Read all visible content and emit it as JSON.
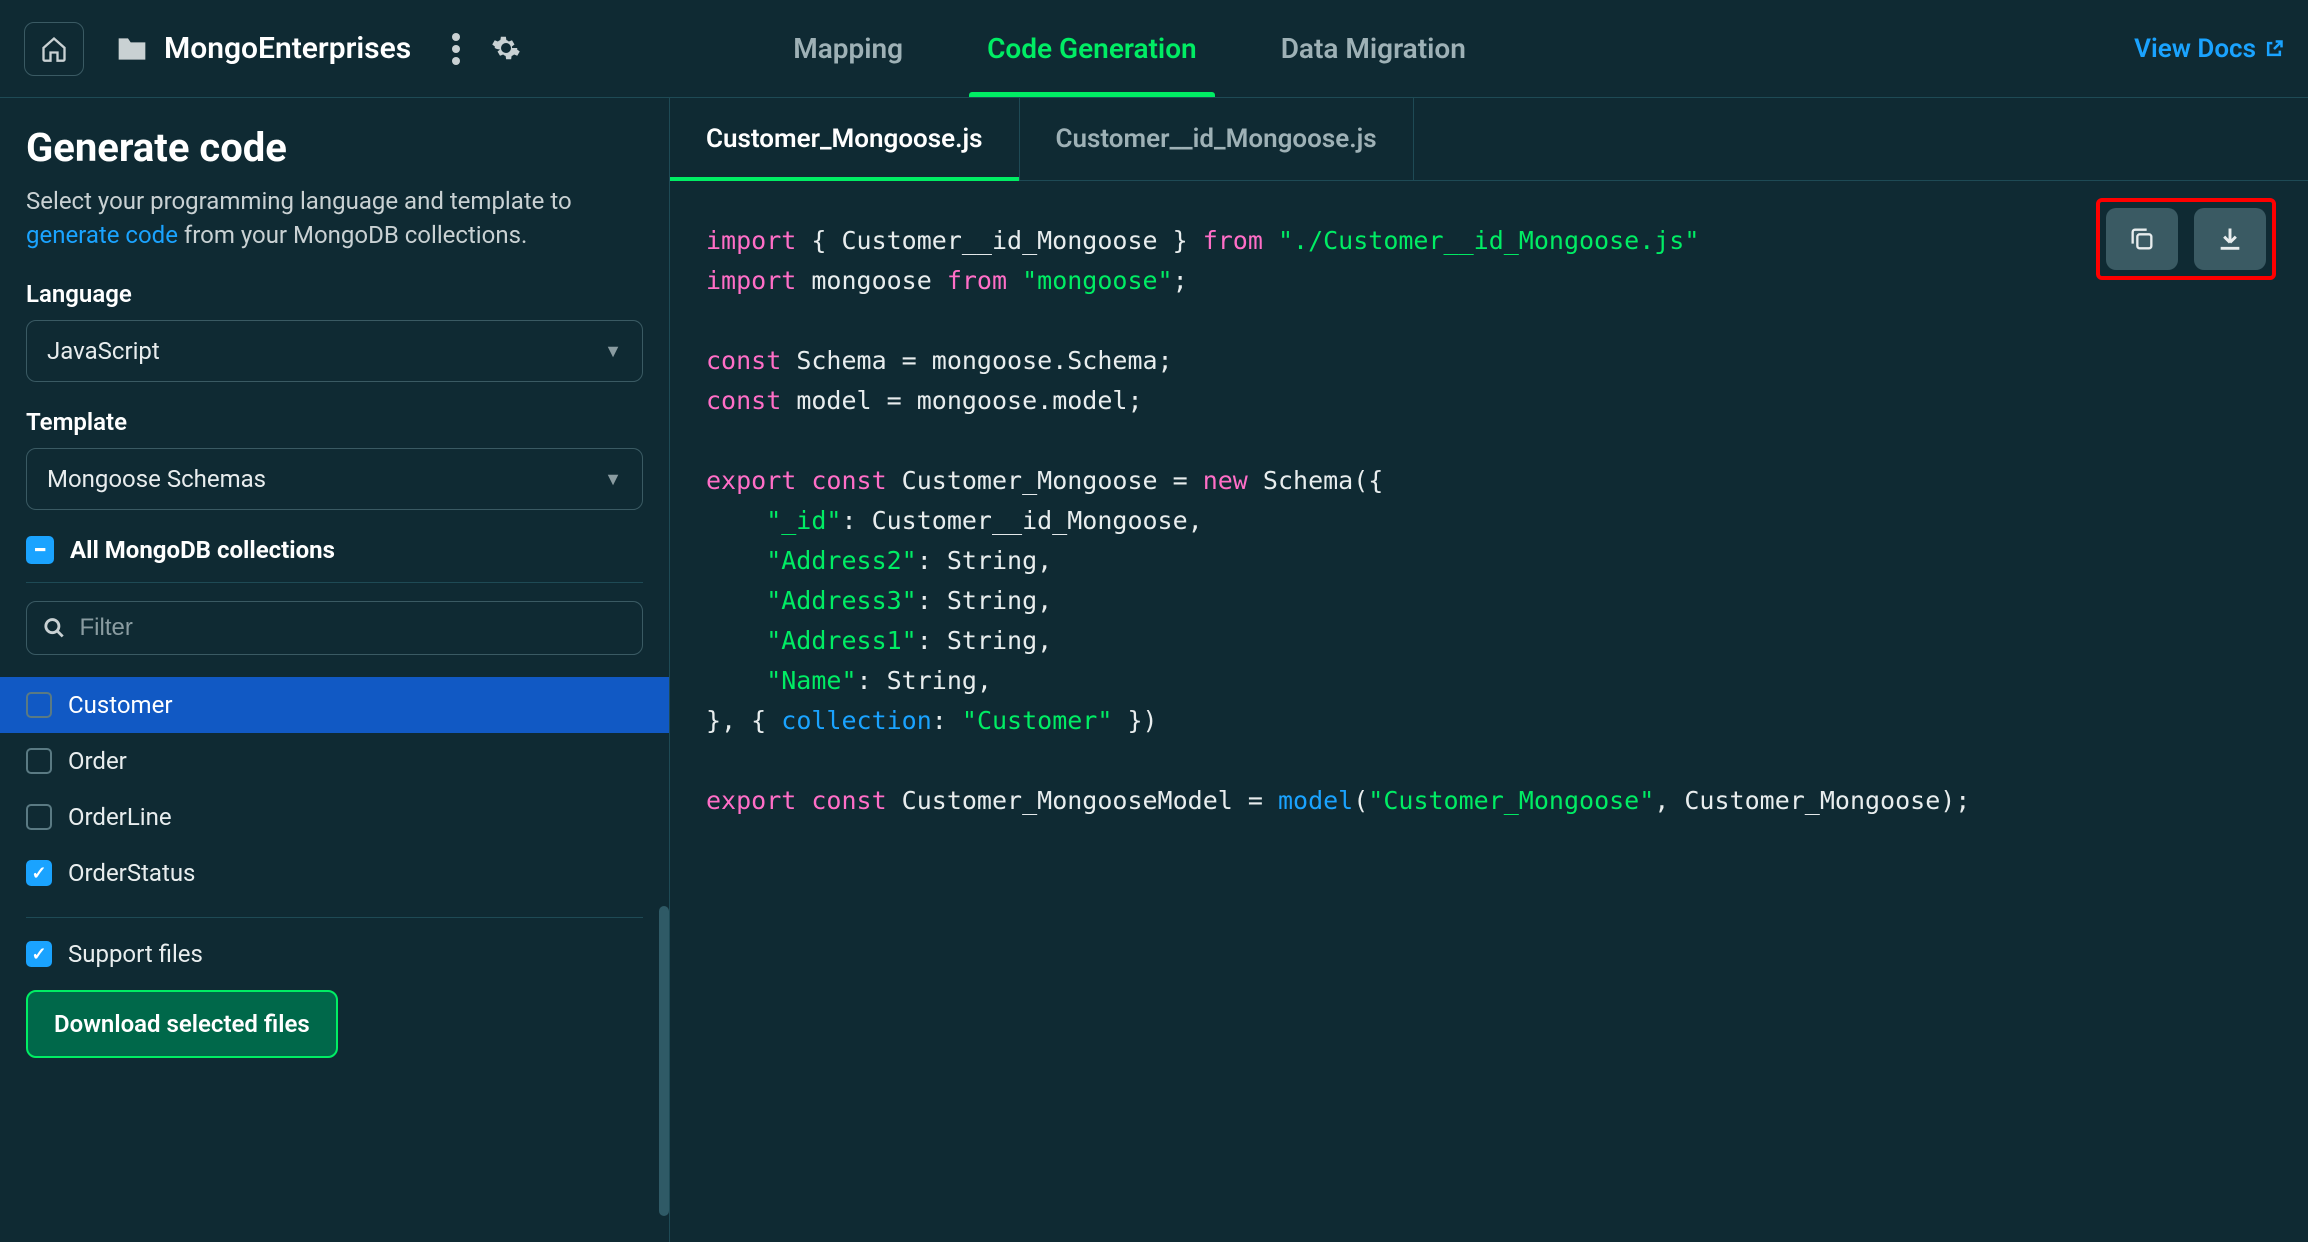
{
  "project_name": "MongoEnterprises",
  "tabs": {
    "mapping": "Mapping",
    "code_generation": "Code Generation",
    "data_migration": "Data Migration"
  },
  "view_docs": "View Docs",
  "sidebar": {
    "title": "Generate code",
    "desc_pre": "Select your programming language and template to ",
    "desc_link": "generate code",
    "desc_post": " from your MongoDB collections.",
    "language_label": "Language",
    "language_value": "JavaScript",
    "template_label": "Template",
    "template_value": "Mongoose Schemas",
    "all_collections": "All MongoDB collections",
    "filter_placeholder": "Filter",
    "collections": [
      {
        "name": "Customer",
        "checked": false,
        "selected": true
      },
      {
        "name": "Order",
        "checked": false,
        "selected": false
      },
      {
        "name": "OrderLine",
        "checked": false,
        "selected": false
      },
      {
        "name": "OrderStatus",
        "checked": true,
        "selected": false
      }
    ],
    "support_files": "Support files",
    "support_files_checked": true,
    "download_btn": "Download selected files"
  },
  "file_tabs": [
    {
      "name": "Customer_Mongoose.js",
      "active": true
    },
    {
      "name": "Customer__id_Mongoose.js",
      "active": false
    }
  ],
  "code": {
    "l1a": "import",
    "l1b": " { Customer__id_Mongoose } ",
    "l1c": "from",
    "l1d": " \"./Customer__id_Mongoose.js\"",
    "l2a": "import",
    "l2b": " mongoose ",
    "l2c": "from",
    "l2d": " \"mongoose\"",
    "l2e": ";",
    "l3a": "const",
    "l3b": " Schema = mongoose.Schema;",
    "l4a": "const",
    "l4b": " model = mongoose.model;",
    "l5a": "export",
    "l5b": " const",
    "l5c": " Customer_Mongoose = ",
    "l5d": "new",
    "l5e": " Schema({",
    "l6a": "    \"_id\"",
    "l6b": ": Customer__id_Mongoose,",
    "l7a": "    \"Address2\"",
    "l7b": ": String,",
    "l8a": "    \"Address3\"",
    "l8b": ": String,",
    "l9a": "    \"Address1\"",
    "l9b": ": String,",
    "l10a": "    \"Name\"",
    "l10b": ": String,",
    "l11a": "}, { ",
    "l11b": "collection",
    "l11c": ": ",
    "l11d": "\"Customer\"",
    "l11e": " })",
    "l12a": "export",
    "l12b": " const",
    "l12c": " Customer_MongooseModel = ",
    "l12d": "model",
    "l12e": "(",
    "l12f": "\"Customer_Mongoose\"",
    "l12g": ", Customer_Mongoose);"
  }
}
